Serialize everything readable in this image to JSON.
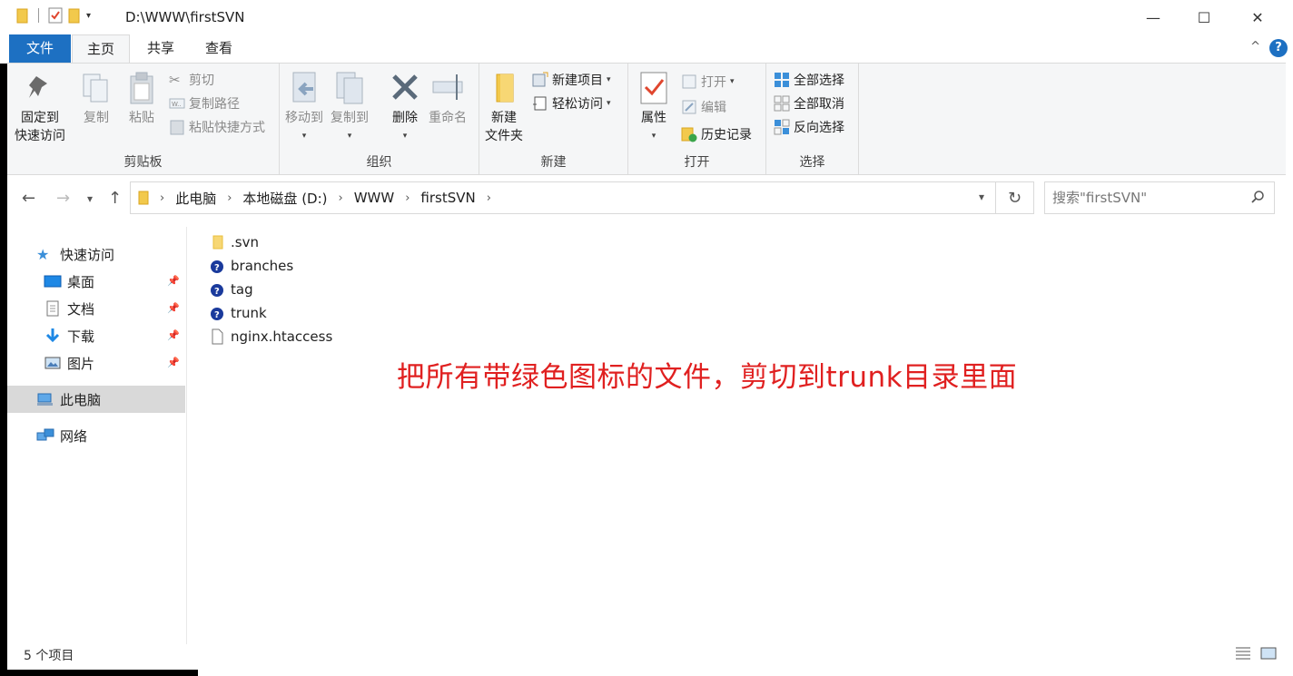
{
  "window": {
    "title": "D:\\WWW\\firstSVN",
    "minimize": "—",
    "maximize": "☐",
    "close": "✕"
  },
  "tabs": [
    {
      "label": "文件"
    },
    {
      "label": "主页"
    },
    {
      "label": "共享"
    },
    {
      "label": "查看"
    }
  ],
  "help_label": "?",
  "ribbon": {
    "clipboard": {
      "label": "剪贴板",
      "pin_line1": "固定到",
      "pin_line2": "快速访问",
      "copy": "复制",
      "paste": "粘贴",
      "cut": "剪切",
      "copy_path": "复制路径",
      "paste_shortcut": "粘贴快捷方式"
    },
    "organize": {
      "label": "组织",
      "move_to": "移动到",
      "copy_to": "复制到",
      "delete": "删除",
      "rename": "重命名"
    },
    "new": {
      "label": "新建",
      "new_folder_line1": "新建",
      "new_folder_line2": "文件夹",
      "new_item": "新建项目",
      "easy_access": "轻松访问"
    },
    "open": {
      "label": "打开",
      "properties": "属性",
      "open": "打开",
      "edit": "编辑",
      "history": "历史记录"
    },
    "select": {
      "label": "选择",
      "select_all": "全部选择",
      "select_none": "全部取消",
      "invert": "反向选择"
    }
  },
  "address": {
    "crumbs": [
      "此电脑",
      "本地磁盘 (D:)",
      "WWW",
      "firstSVN"
    ]
  },
  "search": {
    "placeholder": "搜索\"firstSVN\""
  },
  "nav": {
    "quick_access": "快速访问",
    "desktop": "桌面",
    "documents": "文档",
    "downloads": "下载",
    "pictures": "图片",
    "this_pc": "此电脑",
    "network": "网络"
  },
  "files": [
    {
      "name": ".svn",
      "icon": "folder-icon"
    },
    {
      "name": "branches",
      "icon": "svn-unversioned-folder-icon"
    },
    {
      "name": "tag",
      "icon": "svn-unversioned-folder-icon"
    },
    {
      "name": "trunk",
      "icon": "svn-unversioned-folder-icon"
    },
    {
      "name": "nginx.htaccess",
      "icon": "file-icon"
    }
  ],
  "annotation": "把所有带绿色图标的文件，剪切到trunk目录里面",
  "status": {
    "item_count": "5 个项目"
  },
  "colors": {
    "accent": "#1d70c2",
    "annotation": "#e02020",
    "folder": "#f2c94c"
  }
}
